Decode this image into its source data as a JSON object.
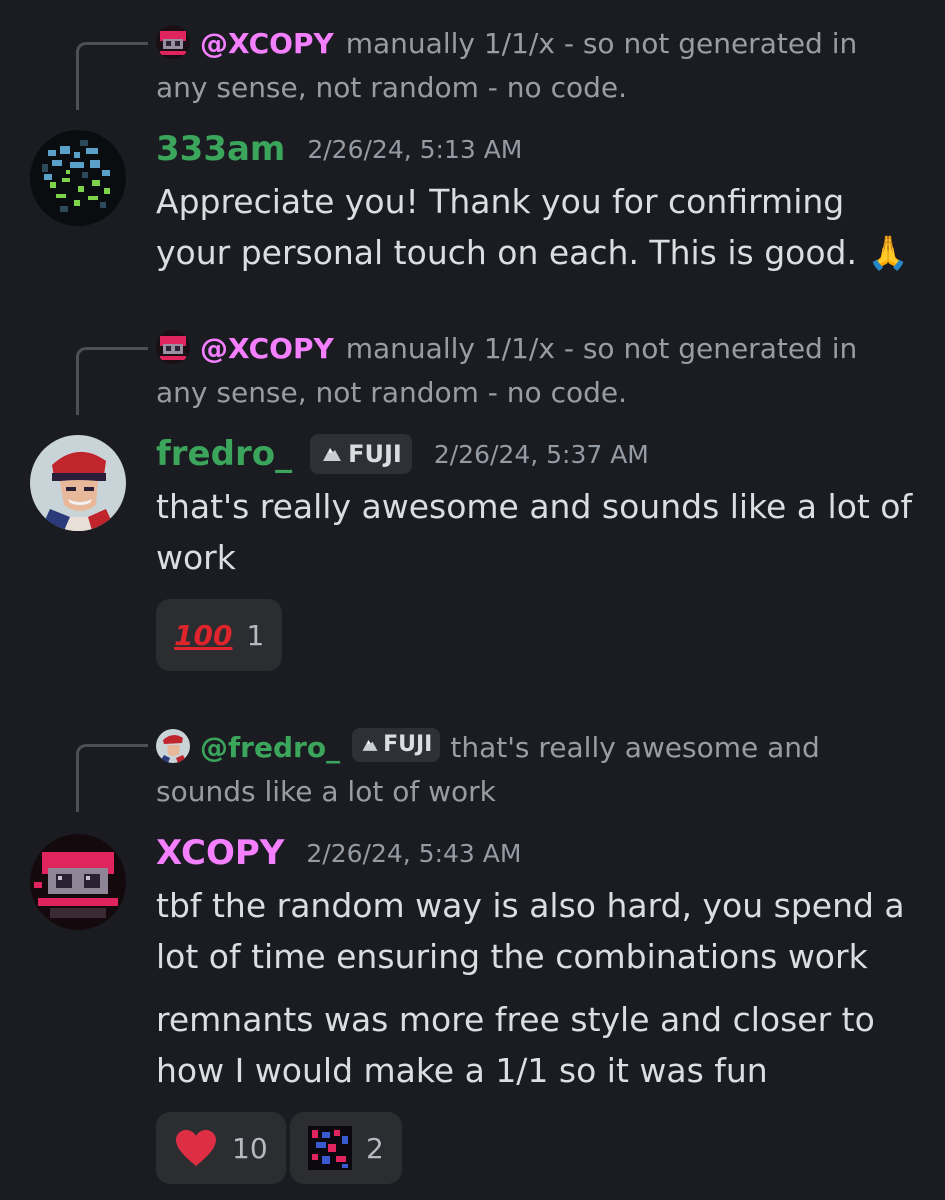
{
  "messages": [
    {
      "reply": {
        "name": "@XCOPY",
        "text": "manually 1/1/x - so not generated in any sense, not random - no code.",
        "name_color": "#f47fff"
      },
      "username": "333am",
      "username_color": "#3ba55c",
      "timestamp": "2/26/24, 5:13 AM",
      "lines": [
        "Appreciate you! Thank you for confirming your personal touch on each. This is good. 🙏"
      ]
    },
    {
      "reply": {
        "name": "@XCOPY",
        "text": "manually 1/1/x - so not generated in any sense, not random - no code.",
        "name_color": "#f47fff"
      },
      "username": "fredro_",
      "username_color": "#3ba55c",
      "role_tag": "FUJI",
      "timestamp": "2/26/24, 5:37 AM",
      "lines": [
        "that's really awesome and sounds like a lot of work"
      ],
      "reactions": [
        {
          "emoji": "💯",
          "count": "1"
        }
      ]
    },
    {
      "reply": {
        "name": "@fredro_",
        "role_tag": "FUJI",
        "text": "that's really awesome and sounds like a lot of work",
        "name_color": "#3ba55c"
      },
      "username": "XCOPY",
      "username_color": "#f47fff",
      "timestamp": "2/26/24, 5:43 AM",
      "lines": [
        "tbf the random way is also hard, you spend a lot of time ensuring the combinations work",
        "remnants was more free style and closer to how I would make a 1/1 so it was fun"
      ],
      "reactions": [
        {
          "emoji": "❤️",
          "count": "10"
        },
        {
          "emoji": "custom-xcopy-emoji",
          "count": "2"
        }
      ]
    }
  ]
}
